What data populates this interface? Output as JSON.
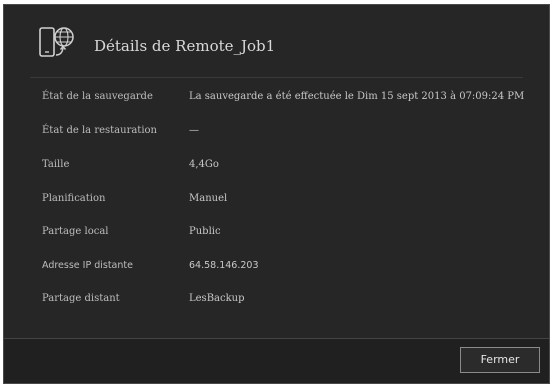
{
  "dialog": {
    "title": "Détails de Remote_Job1",
    "icon": "phone-globe-icon"
  },
  "details": [
    {
      "label": "État de la sauvegarde",
      "value": "La sauvegarde a été effectuée le Dim 15 sept 2013 à 07:09:24 PM"
    },
    {
      "label": "État de la restauration",
      "value": "—"
    },
    {
      "label": "Taille",
      "value": "4,4Go"
    },
    {
      "label": "Planification",
      "value": "Manuel"
    },
    {
      "label": "Partage local",
      "value": "Public"
    },
    {
      "label": "Adresse IP distante",
      "value": "64.58.146.203"
    },
    {
      "label": "Partage distant",
      "value": "LesBackup"
    }
  ],
  "footer": {
    "close_label": "Fermer"
  }
}
